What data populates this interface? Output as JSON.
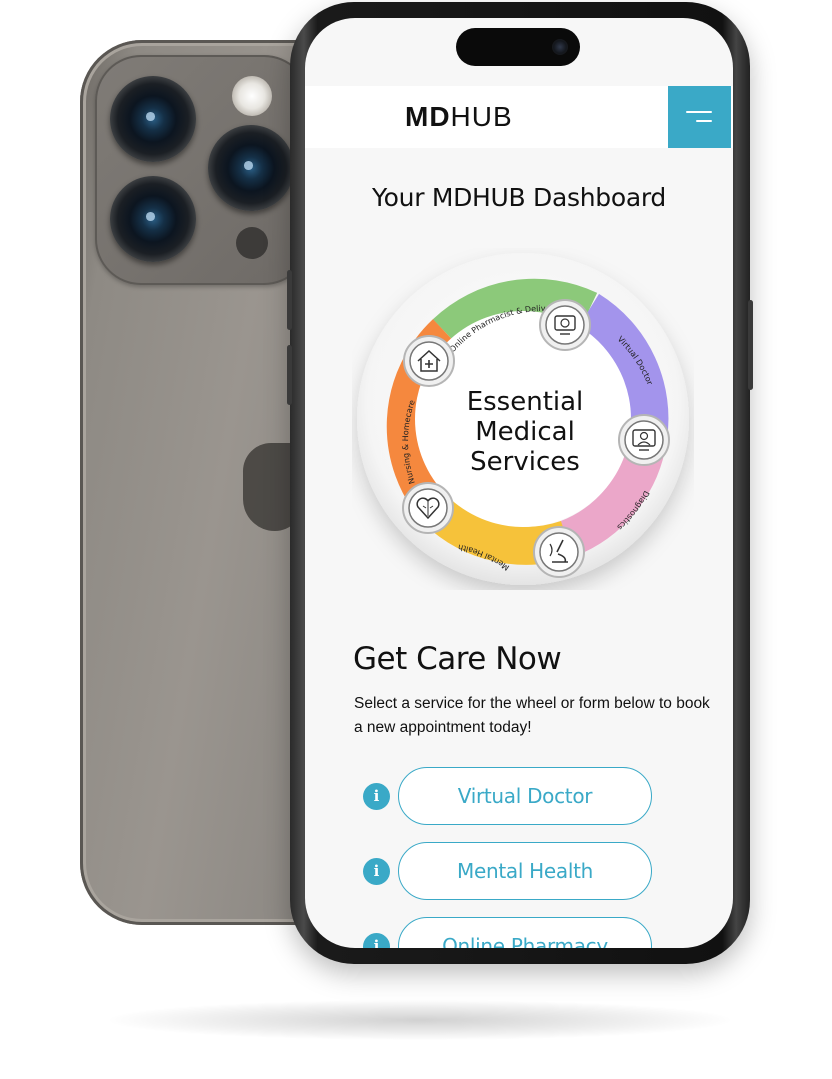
{
  "app": {
    "brand_bold": "MD",
    "brand_light": "HUB"
  },
  "header": {
    "menu_icon": "hamburger-menu-icon"
  },
  "dashboard": {
    "title": "Your MDHUB Dashboard"
  },
  "wheel": {
    "center_lines": [
      "Essential",
      "Medical",
      "Services"
    ],
    "segments": [
      {
        "label": "Online Pharmacist & Delivery",
        "color": "#8cc97a",
        "icon": "pharmacy-icon"
      },
      {
        "label": "Virtual Doctor",
        "color": "#a394ec",
        "icon": "virtual-doctor-icon"
      },
      {
        "label": "Diagnostics",
        "color": "#eba7c9",
        "icon": "microscope-icon"
      },
      {
        "label": "Mental Health",
        "color": "#f6c23a",
        "icon": "brain-heart-icon"
      },
      {
        "label": "Nursing & Homecare",
        "color": "#f5883e",
        "icon": "home-care-icon"
      }
    ]
  },
  "care": {
    "title": "Get Care Now",
    "intro": "Select a service for the wheel or form below to book a new appointment today!",
    "info_glyph": "i",
    "services": [
      {
        "label": "Virtual Doctor"
      },
      {
        "label": "Mental Health"
      },
      {
        "label": "Online Pharmacy"
      }
    ]
  },
  "colors": {
    "accent": "#3aa9c7",
    "background": "#f7f7f7"
  }
}
